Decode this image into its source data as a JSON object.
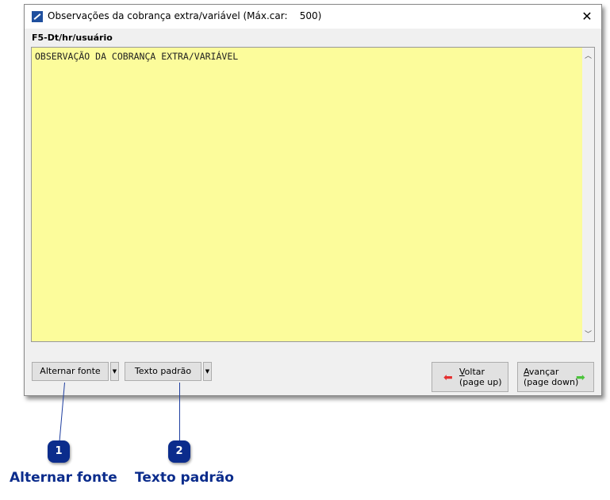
{
  "window": {
    "title": "Observações da cobrança extra/variável (Máx.car:    500)",
    "close_icon": "close-icon"
  },
  "field_label": "F5-Dt/hr/usuário",
  "textarea": {
    "value": "OBSERVAÇÃO DA COBRANÇA EXTRA/VARIÁVEL",
    "background": "#fcfc9b"
  },
  "buttons": {
    "alternar_fonte": "Alternar fonte",
    "texto_padrao": "Texto padrão",
    "voltar": {
      "key": "V",
      "rest": "oltar",
      "sub": "(page up)"
    },
    "avancar": {
      "key": "A",
      "rest": "vançar",
      "sub": "(page down)"
    }
  },
  "callouts": [
    {
      "number": "1",
      "label": "Alternar fonte"
    },
    {
      "number": "2",
      "label": "Texto padrão"
    }
  ],
  "colors": {
    "callout": "#0b2c8c",
    "back_arrow": "#e53030",
    "forward_arrow": "#4cc43c"
  }
}
